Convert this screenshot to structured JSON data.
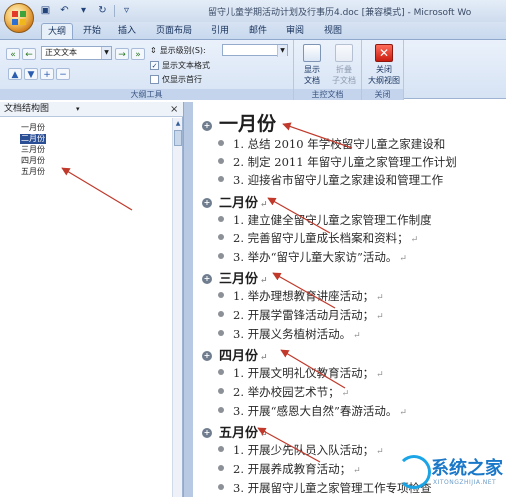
{
  "window": {
    "title": "留守儿童学期活动计划及行事历4.doc [兼容模式] - Microsoft Wo"
  },
  "quick_access": {
    "items": [
      {
        "icon": "save-icon",
        "glyph": "▣"
      },
      {
        "icon": "undo-icon",
        "glyph": "↶"
      },
      {
        "icon": "dropdown-icon",
        "glyph": "▾"
      },
      {
        "icon": "redo-icon",
        "glyph": "↻"
      },
      {
        "icon": "customize-icon",
        "glyph": "▿"
      }
    ]
  },
  "tabs": [
    {
      "label": "大纲",
      "active": true
    },
    {
      "label": "开始",
      "active": false
    },
    {
      "label": "插入",
      "active": false
    },
    {
      "label": "页面布局",
      "active": false
    },
    {
      "label": "引用",
      "active": false
    },
    {
      "label": "邮件",
      "active": false
    },
    {
      "label": "审阅",
      "active": false
    },
    {
      "label": "视图",
      "active": false
    }
  ],
  "ribbon": {
    "outline_tools": {
      "label": "大纲工具",
      "level_value": "正文文本",
      "show_level_label": "显示级别(S):",
      "show_text_format_label": "显示文本格式",
      "show_text_format_checked": true,
      "first_line_only_label": "仅显示首行",
      "first_line_only_checked": false,
      "buttons": [
        {
          "icon": "promote-to-heading1-icon",
          "glyph": "«"
        },
        {
          "icon": "promote-icon",
          "glyph": "←"
        },
        {
          "icon": "demote-icon",
          "glyph": "→"
        },
        {
          "icon": "demote-to-body-icon",
          "glyph": "»"
        },
        {
          "icon": "move-up-icon",
          "glyph": "▲"
        },
        {
          "icon": "move-down-icon",
          "glyph": "▼"
        },
        {
          "icon": "expand-icon",
          "glyph": "+"
        },
        {
          "icon": "collapse-icon",
          "glyph": "−"
        }
      ]
    },
    "master_document": {
      "label": "主控文档",
      "show_document_label_1": "显示",
      "show_document_label_2": "文档",
      "collapse_subdocs_label_1": "折叠",
      "collapse_subdocs_label_2": "子文档"
    },
    "close": {
      "label": "关闭",
      "close_outline_label_1": "关闭",
      "close_outline_label_2": "大纲视图",
      "close_glyph": "✕"
    }
  },
  "doc_map": {
    "title": "文档结构图",
    "dropdown_glyph": "▾",
    "close_glyph": "×",
    "items": [
      {
        "label": "一月份",
        "selected": false
      },
      {
        "label": "二月份",
        "selected": true
      },
      {
        "label": "三月份",
        "selected": false
      },
      {
        "label": "四月份",
        "selected": false
      },
      {
        "label": "五月份",
        "selected": false
      }
    ]
  },
  "document": {
    "heading_glyph": "+",
    "para_mark": "↵",
    "sections": [
      {
        "heading": "一月份",
        "items": [
          "1. 总结 2010 年学校留守儿童之家建设和",
          "2. 制定 2011 年留守儿童之家管理工作计划",
          "3. 迎接省市留守儿童之家建设和管理工作"
        ]
      },
      {
        "heading": "二月份",
        "items": [
          "1. 建立健全留守儿童之家管理工作制度",
          "2. 完善留守儿童成长档案和资料；",
          "3. 举办“留守儿童大家访”活动。"
        ]
      },
      {
        "heading": "三月份",
        "items": [
          "1. 举办理想教育讲座活动；",
          "2. 开展学雷锋活动月活动；",
          "3. 开展义务植树活动。"
        ]
      },
      {
        "heading": "四月份",
        "items": [
          "1. 开展文明礼仪教育活动；",
          "2. 举办校园艺术节；",
          "3. 开展“感恩大自然”春游活动。"
        ]
      },
      {
        "heading": "五月份",
        "items": [
          "1. 开展少先队员入队活动；",
          "2. 开展养成教育活动；",
          "3. 开展留守儿童之家管理工作专项检查"
        ]
      }
    ]
  },
  "watermark": {
    "text": "系统之家",
    "sub": "XITONGZHIJIA.NET"
  },
  "colors": {
    "annotation_arrow": "#c0392b",
    "selection": "#2b4f95",
    "watermark": "#1b78c9"
  }
}
